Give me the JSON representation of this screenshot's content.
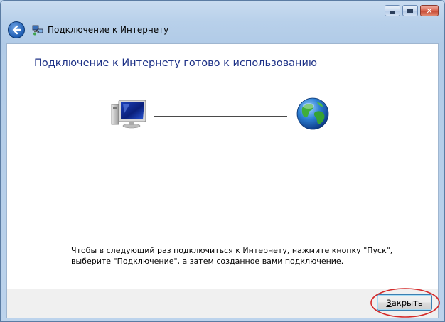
{
  "window": {
    "title": "Подключение к Интернету",
    "caption_buttons": [
      "minimize",
      "maximize",
      "close"
    ]
  },
  "main": {
    "heading": "Подключение к Интернету готово к использованию",
    "diagram": {
      "left_icon": "computer-icon",
      "right_icon": "globe-icon"
    },
    "info_line1": "Чтобы в следующий раз подключиться к Интернету, нажмите кнопку \"Пуск\",",
    "info_line2": "выберите \"Подключение\", а затем созданное вами подключение."
  },
  "footer": {
    "close_button_accesskey": "З",
    "close_button_rest": "акрыть"
  },
  "annotation": {
    "highlight_color": "#d42a2a"
  }
}
